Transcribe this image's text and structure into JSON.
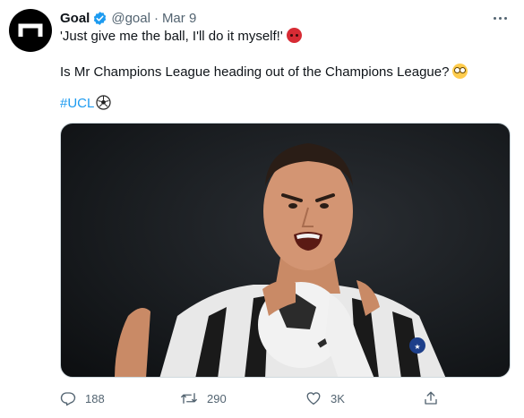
{
  "tweet": {
    "author_name": "Goal",
    "author_handle": "@goal",
    "separator": "·",
    "date": "Mar 9",
    "line1": "'Just give me the ball, I'll do it myself!'",
    "line1_emoji": "angry-face-emoji",
    "line2": "Is Mr Champions League heading out of the Champions League?",
    "line2_emoji": "flushed-face-emoji",
    "hashtag": "#UCL",
    "hashtag_emoji": "soccer-ball-emoji"
  },
  "actions": {
    "reply_count": "188",
    "retweet_count": "290",
    "like_count": "3K"
  },
  "colors": {
    "link": "#1d9bf0",
    "muted": "#536471",
    "verified": "#1d9bf0",
    "avatar_bg": "#000000"
  },
  "icons": [
    "goal-logo-icon",
    "verified-badge-icon",
    "more-icon",
    "reply-icon",
    "retweet-icon",
    "like-icon",
    "share-icon"
  ]
}
